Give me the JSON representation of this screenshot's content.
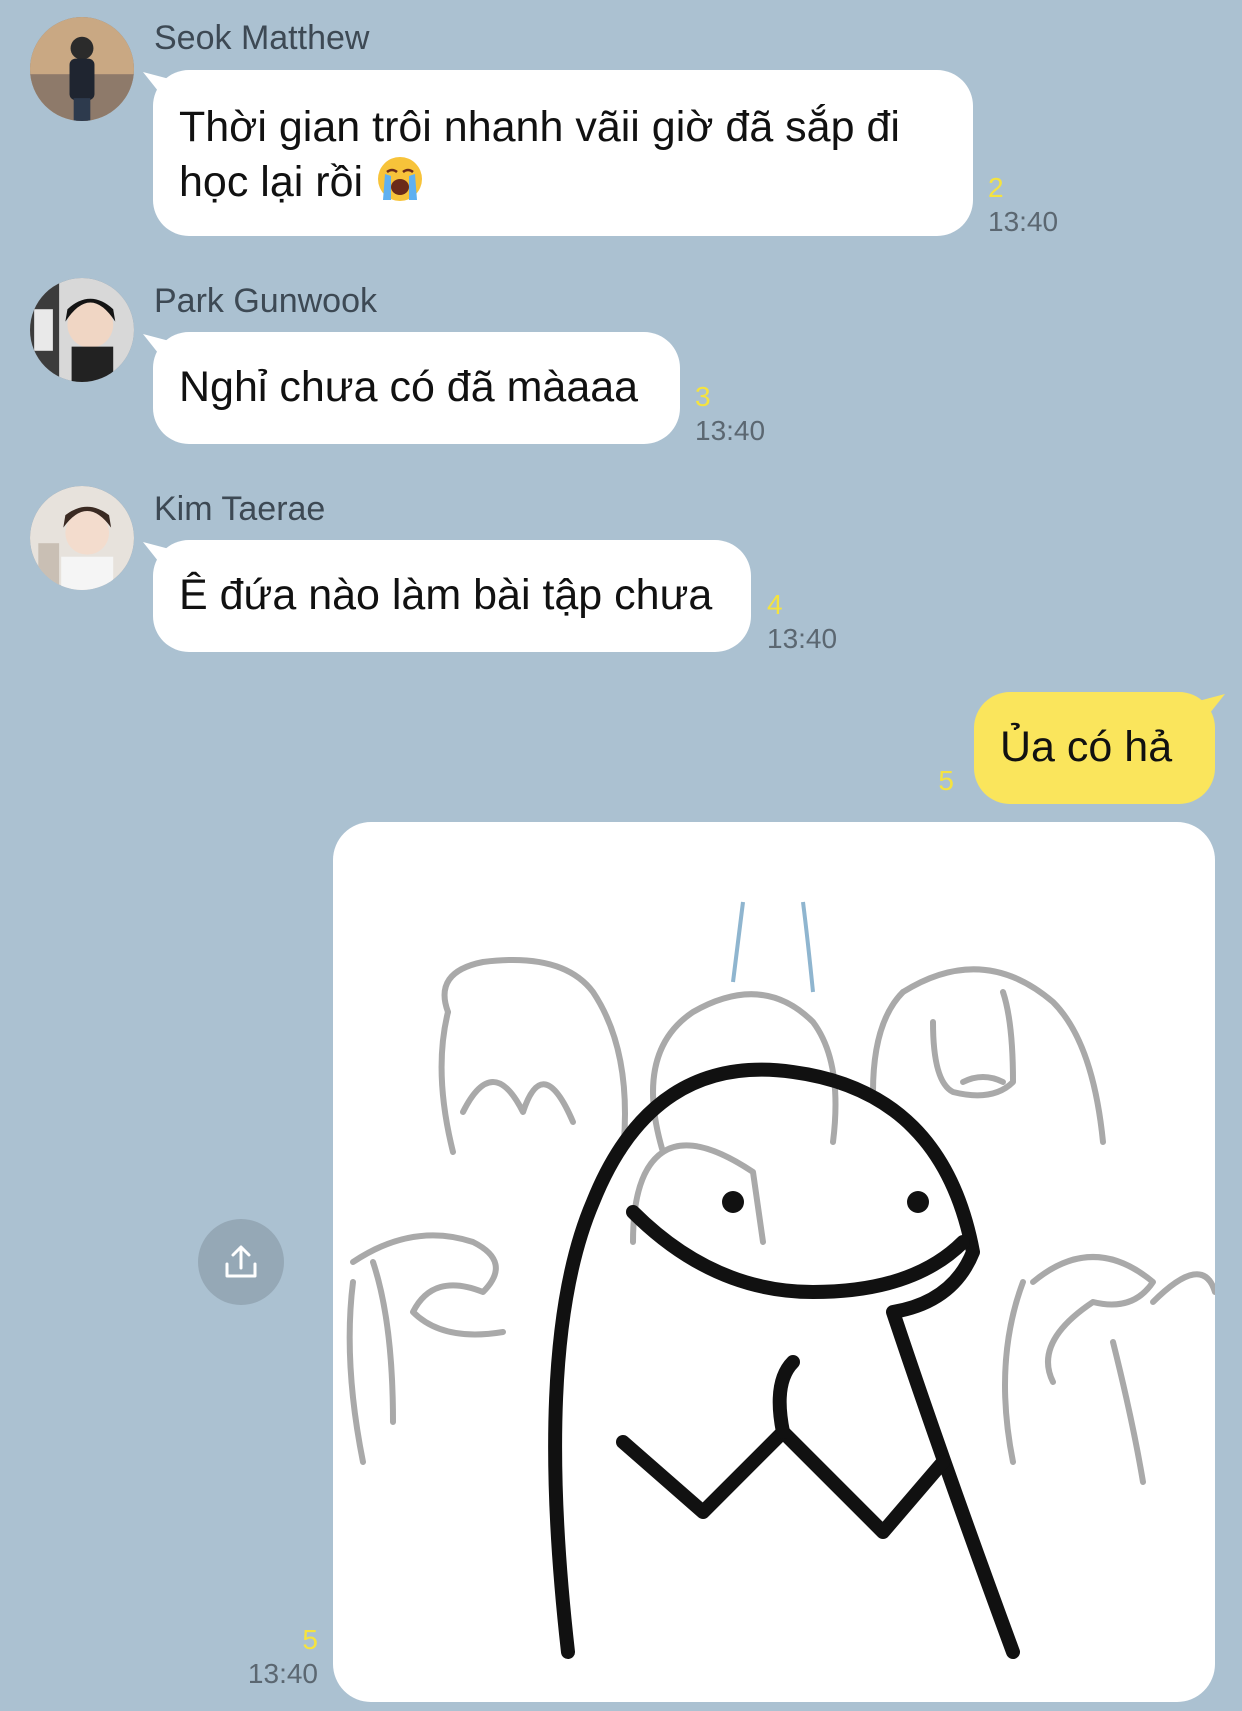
{
  "messages": [
    {
      "sender": "Seok Matthew",
      "line1": "Thời gian trôi nhanh vãii giờ đã sắp đi",
      "line2": "học lại rồi",
      "emoji": "loudly-crying-face-emoji",
      "unread": "2",
      "time": "13:40"
    },
    {
      "sender": "Park Gunwook",
      "text": "Nghỉ chưa có đã màaaa",
      "unread": "3",
      "time": "13:40"
    },
    {
      "sender": "Kim Taerae",
      "text": "Ê đứa nào làm bài tập chưa",
      "unread": "4",
      "time": "13:40"
    }
  ],
  "outgoing": [
    {
      "text": "Ủa có hả",
      "unread": "5"
    },
    {
      "type": "sticker-image",
      "image": "smiling-blob-meme",
      "unread": "5",
      "time": "13:40"
    }
  ],
  "icons": {
    "share": "share-upload-icon"
  },
  "colors": {
    "background": "#abc1d1",
    "incoming_bubble": "#ffffff",
    "outgoing_bubble": "#fae55c",
    "unread_count": "#f5e33f"
  }
}
